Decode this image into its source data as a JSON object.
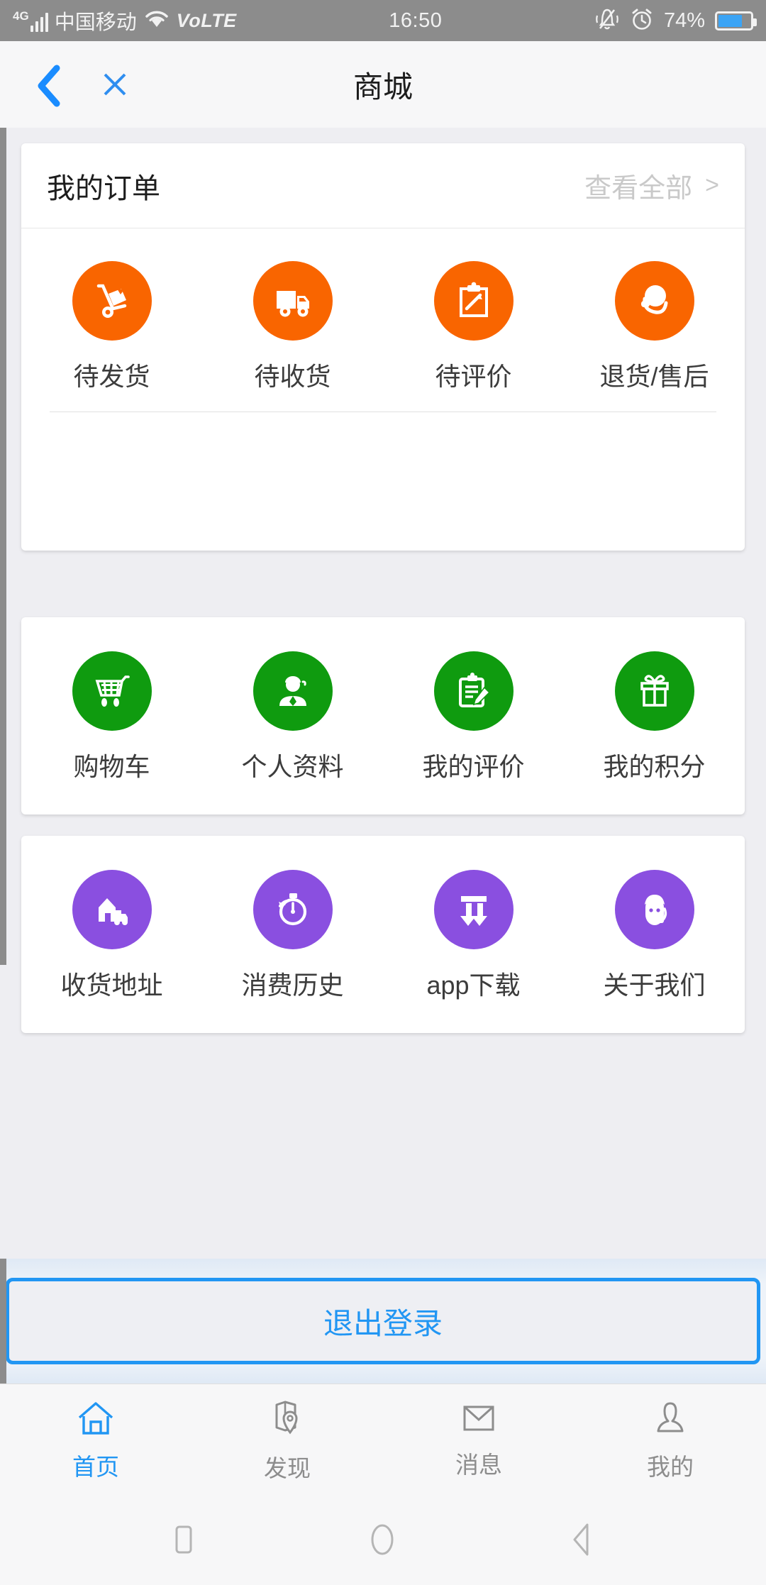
{
  "status_bar": {
    "network_type": "4G",
    "carrier": "中国移动",
    "volte": "VoLTE",
    "time": "16:50",
    "battery_percent": "74%",
    "battery_level": 74,
    "icons": [
      "signal-bars-icon",
      "wifi-icon",
      "mute-bell-icon",
      "alarm-clock-icon",
      "battery-icon"
    ],
    "bar_color": "#8c8c8c",
    "battery_fill_color": "#3ba4f5"
  },
  "header": {
    "title": "商城",
    "back_icon": "chevron-left-icon",
    "close_icon": "close-x-icon",
    "accent_color": "#1a8cff",
    "background": "#f7f7f8"
  },
  "orders_card": {
    "title": "我的订单",
    "view_all_label": "查看全部",
    "view_all_chevron": ">",
    "accent_color": "#f96500",
    "items": [
      {
        "label": "待发货",
        "icon": "hand-truck-icon"
      },
      {
        "label": "待收货",
        "icon": "delivery-truck-icon"
      },
      {
        "label": "待评价",
        "icon": "clipboard-pen-icon"
      },
      {
        "label": "退货/售后",
        "icon": "headset-support-icon"
      }
    ]
  },
  "green_card": {
    "accent_color": "#0f9b0f",
    "items": [
      {
        "label": "购物车",
        "icon": "shopping-cart-icon"
      },
      {
        "label": "个人资料",
        "icon": "person-profile-icon"
      },
      {
        "label": "我的评价",
        "icon": "clipboard-pencil-icon"
      },
      {
        "label": "我的积分",
        "icon": "gift-box-icon"
      }
    ]
  },
  "purple_card": {
    "accent_color": "#8a4fe0",
    "items": [
      {
        "label": "收货地址",
        "icon": "house-delivery-icon"
      },
      {
        "label": "消费历史",
        "icon": "stopwatch-icon"
      },
      {
        "label": "app下载",
        "icon": "double-down-arrow-icon"
      },
      {
        "label": "关于我们",
        "icon": "support-agent-icon"
      }
    ]
  },
  "logout": {
    "label": "退出登录",
    "color": "#2196f3"
  },
  "tab_bar": {
    "active_color": "#2196f3",
    "inactive_color": "#8d8d8d",
    "tabs": [
      {
        "label": "首页",
        "icon": "home-icon",
        "active": true
      },
      {
        "label": "发现",
        "icon": "map-pin-icon",
        "active": false
      },
      {
        "label": "消息",
        "icon": "envelope-icon",
        "active": false
      },
      {
        "label": "我的",
        "icon": "person-icon",
        "active": false
      }
    ]
  },
  "nav_bar": {
    "buttons": [
      {
        "icon": "recents-square-icon"
      },
      {
        "icon": "home-circle-icon"
      },
      {
        "icon": "back-triangle-icon"
      }
    ]
  }
}
